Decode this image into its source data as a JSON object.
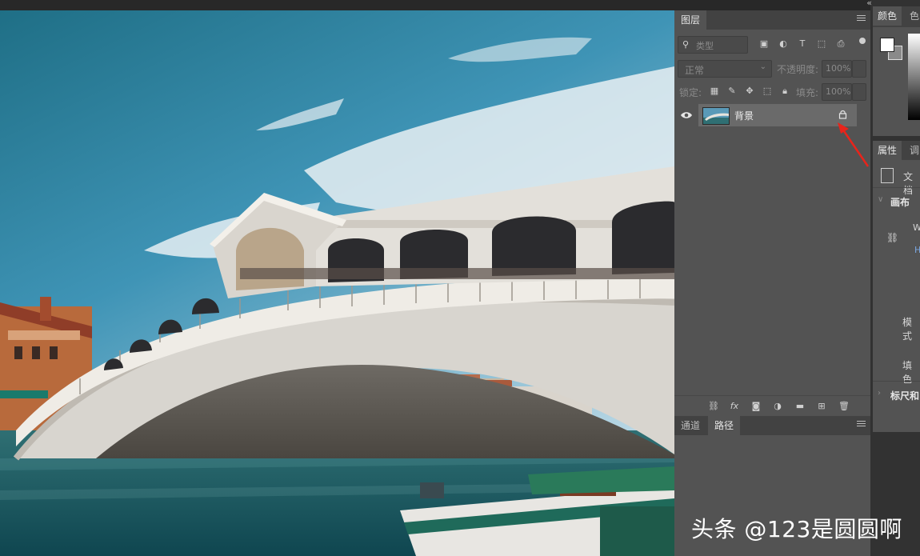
{
  "layers_panel": {
    "tab_label": "图层",
    "filter_placeholder": "类型",
    "blend_mode": "正常",
    "opacity_label": "不透明度:",
    "opacity_value": "100%",
    "lock_label": "锁定:",
    "fill_label": "填充:",
    "fill_value": "100%",
    "layers": [
      {
        "name": "背景"
      }
    ]
  },
  "bottom_panel": {
    "tabs": [
      "通道",
      "路径"
    ]
  },
  "color_panel": {
    "tabs": [
      "颜色",
      "色"
    ]
  },
  "properties_panel": {
    "tabs": [
      "属性",
      "调"
    ],
    "doc_label": "文档",
    "canvas_section": "画布",
    "w_label": "W",
    "h_label": "H",
    "mode_label": "模式",
    "fill_label": "填色",
    "rulers_section": "标尺和"
  },
  "topbar": {
    "collapse_glyph": "«"
  },
  "watermark": "头条 @123是圆圆啊",
  "colors": {
    "panel": "#535353",
    "tab_active": "#535353",
    "tab_bar": "#424242",
    "annotation_arrow": "#e8241b"
  }
}
